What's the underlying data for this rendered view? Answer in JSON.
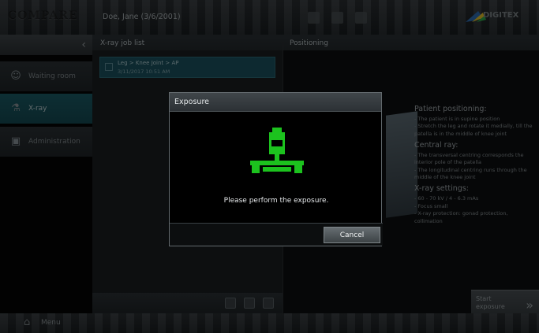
{
  "header": {
    "logo_text": "COMPARE",
    "patient_name": "Doe, Jane  (3/6/2001)",
    "brand_text": "DIGITEX"
  },
  "sidebar": {
    "items": [
      {
        "label": "Waiting room",
        "icon": "waiting-room-icon"
      },
      {
        "label": "X-ray",
        "icon": "xray-icon",
        "active": true
      },
      {
        "label": "Administration",
        "icon": "administration-icon"
      }
    ]
  },
  "joblist": {
    "title": "X-ray job list",
    "job": {
      "title": "Leg > Knee Joint > AP",
      "date": "3/11/2017 10:51 AM"
    }
  },
  "positioning": {
    "title": "Positioning",
    "patient_heading": "Patient positioning:",
    "patient_lines": [
      "- The patient is in supine position",
      "- Stretch the leg and rotate it medially, till the patella is in the middle of knee joint"
    ],
    "central_heading": "Central ray:",
    "central_lines": [
      "- The transversal centring corresponds the interior pole of the patella",
      "- The longitudinal centring runs through the middle of the knee joint"
    ],
    "settings_heading": "X-ray settings:",
    "settings_lines": [
      "- 60 - 70 kV / 4 - 6.3 mAs",
      "- Focus small",
      "- X-ray protection: gonad protection, collimation"
    ],
    "start_label": "Start exposure"
  },
  "bottom": {
    "menu_label": "Menu"
  },
  "dialog": {
    "title": "Exposure",
    "message": "Please perform the exposure.",
    "cancel_label": "Cancel"
  },
  "colors": {
    "accent_teal": "#1a5360",
    "exposure_green": "#1cc21e"
  }
}
